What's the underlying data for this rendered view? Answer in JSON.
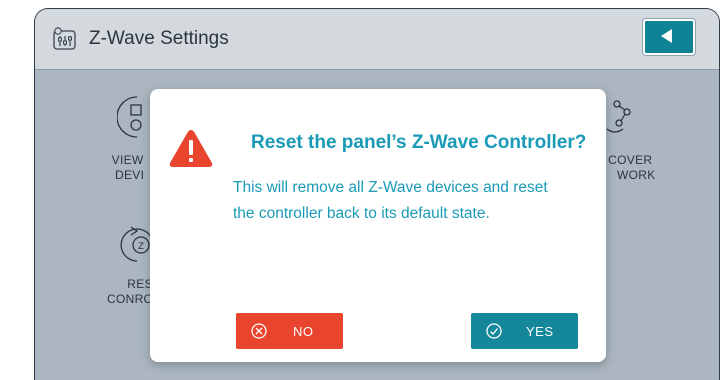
{
  "header": {
    "title": "Z-Wave Settings",
    "title_icon": "zwave-settings-icon",
    "back_icon": "back-arrow-icon"
  },
  "background_tiles": [
    {
      "label_line1": "VIEW",
      "label_line2": "DEVI",
      "icon": "devices-icon"
    },
    {
      "label_line1": "COVER",
      "label_line2": "WORK",
      "icon": "network-discover-icon"
    },
    {
      "label_line1": "RES",
      "label_line2": "CONRO",
      "icon": "reset-controller-icon"
    }
  ],
  "dialog": {
    "title": "Reset the panel’s Z-Wave Controller?",
    "message": "This will remove all Z-Wave devices and reset the controller back to its default state.",
    "warning_icon": "warning-icon",
    "no_label": "NO",
    "yes_label": "YES",
    "no_icon": "cancel-circle-icon",
    "yes_icon": "check-circle-icon"
  },
  "colors": {
    "accent": "#1a9ab6",
    "no_button": "#e8442e",
    "yes_button": "#14879b",
    "warning": "#e8442e"
  }
}
